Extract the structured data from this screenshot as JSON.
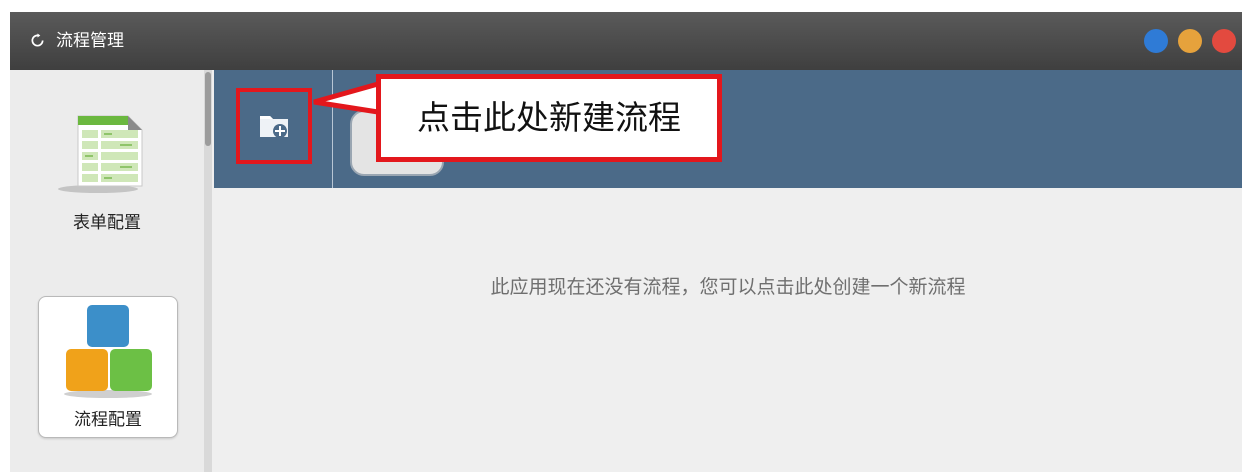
{
  "window": {
    "title": "流程管理",
    "title_icon": "refresh-icon",
    "controls": [
      {
        "name": "minimize",
        "color": "#2f7bd6"
      },
      {
        "name": "maximize",
        "color": "#e6a23c"
      },
      {
        "name": "close",
        "color": "#e34a3f"
      }
    ]
  },
  "sidebar": {
    "items": [
      {
        "label": "表单配置",
        "icon": "form-table-icon",
        "selected": false
      },
      {
        "label": "流程配置",
        "icon": "process-blocks-icon",
        "selected": true
      }
    ]
  },
  "toolbar": {
    "add_icon": "new-folder-plus-icon",
    "callout_text": "点击此处新建流程",
    "accent": "#e3171c",
    "background": "#4b6a88"
  },
  "content": {
    "empty_message": "此应用现在还没有流程，您可以点击此处创建一个新流程"
  }
}
